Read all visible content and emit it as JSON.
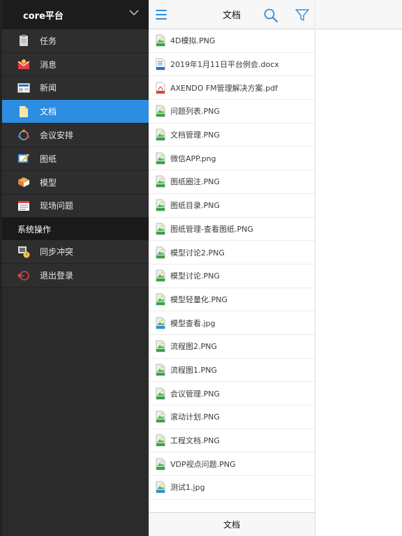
{
  "sidebar": {
    "title": "core平台",
    "items": [
      {
        "label": "任务",
        "icon": "clipboard-icon"
      },
      {
        "label": "消息",
        "icon": "mail-icon"
      },
      {
        "label": "新闻",
        "icon": "news-icon"
      },
      {
        "label": "文档",
        "icon": "document-icon",
        "active": true
      },
      {
        "label": "会议安排",
        "icon": "meeting-icon"
      },
      {
        "label": "图纸",
        "icon": "drawing-icon"
      },
      {
        "label": "模型",
        "icon": "model-icon"
      },
      {
        "label": "现场问题",
        "icon": "issue-icon"
      }
    ],
    "section_title": "系统操作",
    "system_items": [
      {
        "label": "同步冲突",
        "icon": "sync-conflict-icon"
      },
      {
        "label": "退出登录",
        "icon": "logout-icon"
      }
    ]
  },
  "list_header": {
    "title": "文档"
  },
  "files": [
    {
      "name": "4D模拟.PNG",
      "type": "PNG"
    },
    {
      "name": "2019年1月11日平台例会.docx",
      "type": "DOC"
    },
    {
      "name": "AXENDO FM管理解决方案.pdf",
      "type": "PDF"
    },
    {
      "name": "问题列表.PNG",
      "type": "PNG"
    },
    {
      "name": "文档管理.PNG",
      "type": "PNG"
    },
    {
      "name": "微信APP.png",
      "type": "PNG"
    },
    {
      "name": "图纸圈注.PNG",
      "type": "PNG"
    },
    {
      "name": "图纸目录.PNG",
      "type": "PNG"
    },
    {
      "name": "图纸管理-查看图纸.PNG",
      "type": "PNG"
    },
    {
      "name": "模型讨论2.PNG",
      "type": "PNG"
    },
    {
      "name": "模型讨论.PNG",
      "type": "PNG"
    },
    {
      "name": "模型轻量化.PNG",
      "type": "PNG"
    },
    {
      "name": "模型查看.jpg",
      "type": "JPG"
    },
    {
      "name": "流程图2.PNG",
      "type": "PNG"
    },
    {
      "name": "流程图1.PNG",
      "type": "PNG"
    },
    {
      "name": "会议管理.PNG",
      "type": "PNG"
    },
    {
      "name": "滚动计划.PNG",
      "type": "PNG"
    },
    {
      "name": "工程文档.PNG",
      "type": "PNG"
    },
    {
      "name": "VDP视点问题.PNG",
      "type": "PNG"
    },
    {
      "name": "测试1.jpg",
      "type": "JPG"
    }
  ],
  "footer": {
    "label": "文档"
  },
  "colors": {
    "accent": "#2d8de0",
    "sidebar_bg": "#2e2e2e"
  }
}
